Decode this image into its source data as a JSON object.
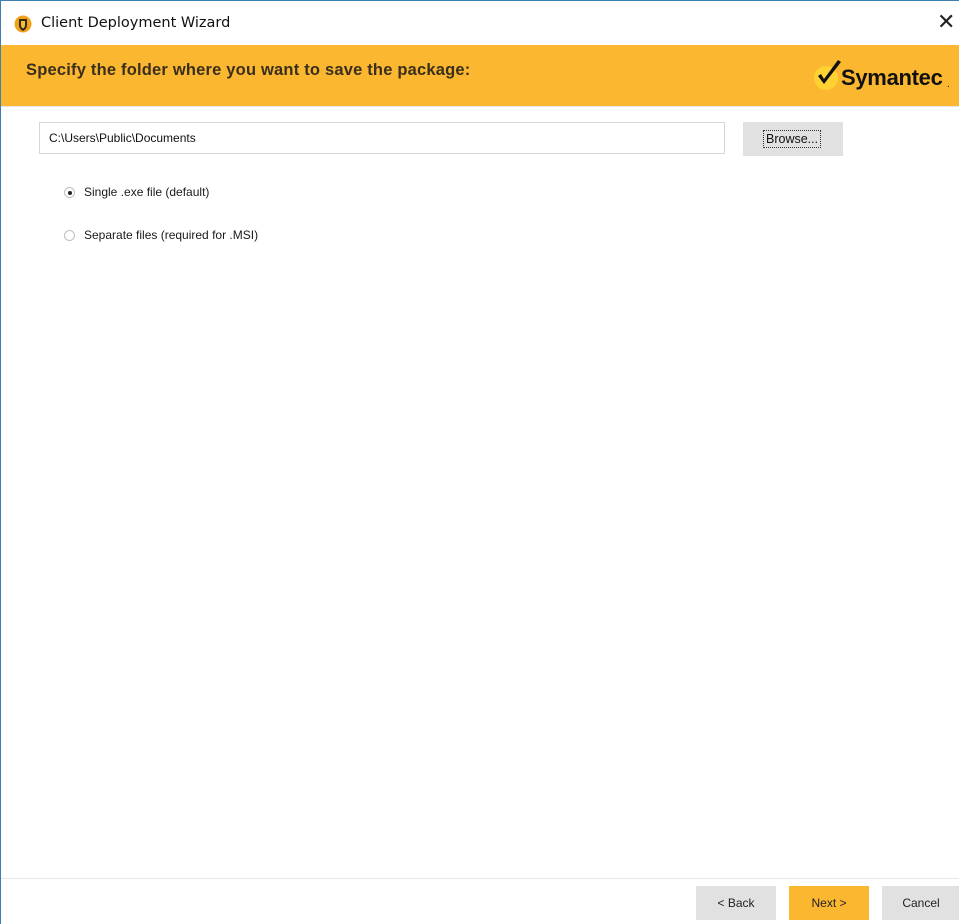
{
  "window": {
    "title": "Client Deployment Wizard",
    "close_glyph": "✕"
  },
  "header": {
    "title": "Specify the folder where you want to save the package:",
    "brand": "Symantec",
    "brand_dot": ".",
    "background_color": "#fbb730"
  },
  "folder": {
    "path_value": "C:\\Users\\Public\\Documents",
    "browse_label": "Browse..."
  },
  "options": [
    {
      "label": "Single .exe file (default)",
      "selected": true
    },
    {
      "label": "Separate files (required for .MSI)",
      "selected": false
    }
  ],
  "footer": {
    "back_label": "< Back",
    "next_label": "Next >",
    "cancel_label": "Cancel"
  },
  "icons": {
    "app": "shield-icon",
    "close": "close-icon",
    "logo": "checkmark-logo-icon"
  }
}
